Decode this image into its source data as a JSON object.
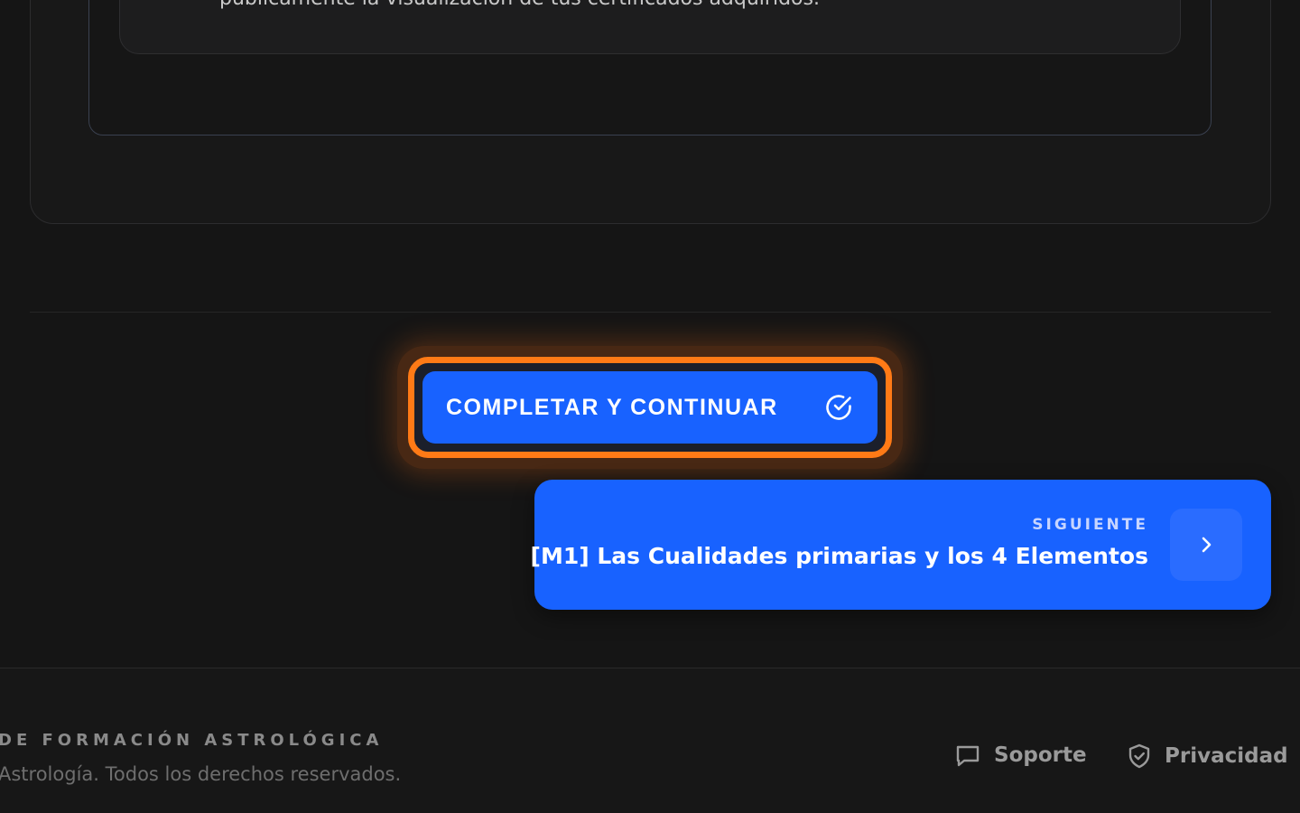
{
  "lesson": {
    "note_text": "públicamente la visualización de tus certificados adquiridos."
  },
  "actions": {
    "complete_label": "COMPLETAR Y CONTINUAR",
    "complete_icon": "check-circle-icon"
  },
  "next_lesson": {
    "kicker": "SIGUIENTE",
    "title": "[M1] Las Cualidades primarias y los 4 Elementos",
    "icon": "chevron-right-icon"
  },
  "footer": {
    "brand": "DE FORMACIÓN ASTROLÓGICA",
    "copyright": "Astrología. Todos los derechos reservados.",
    "links": [
      {
        "label": "Soporte",
        "icon": "chat-icon"
      },
      {
        "label": "Privacidad",
        "icon": "shield-check-icon"
      }
    ]
  },
  "colors": {
    "background": "#151515",
    "primary": "#1862ff",
    "highlight": "#ff7a16"
  }
}
